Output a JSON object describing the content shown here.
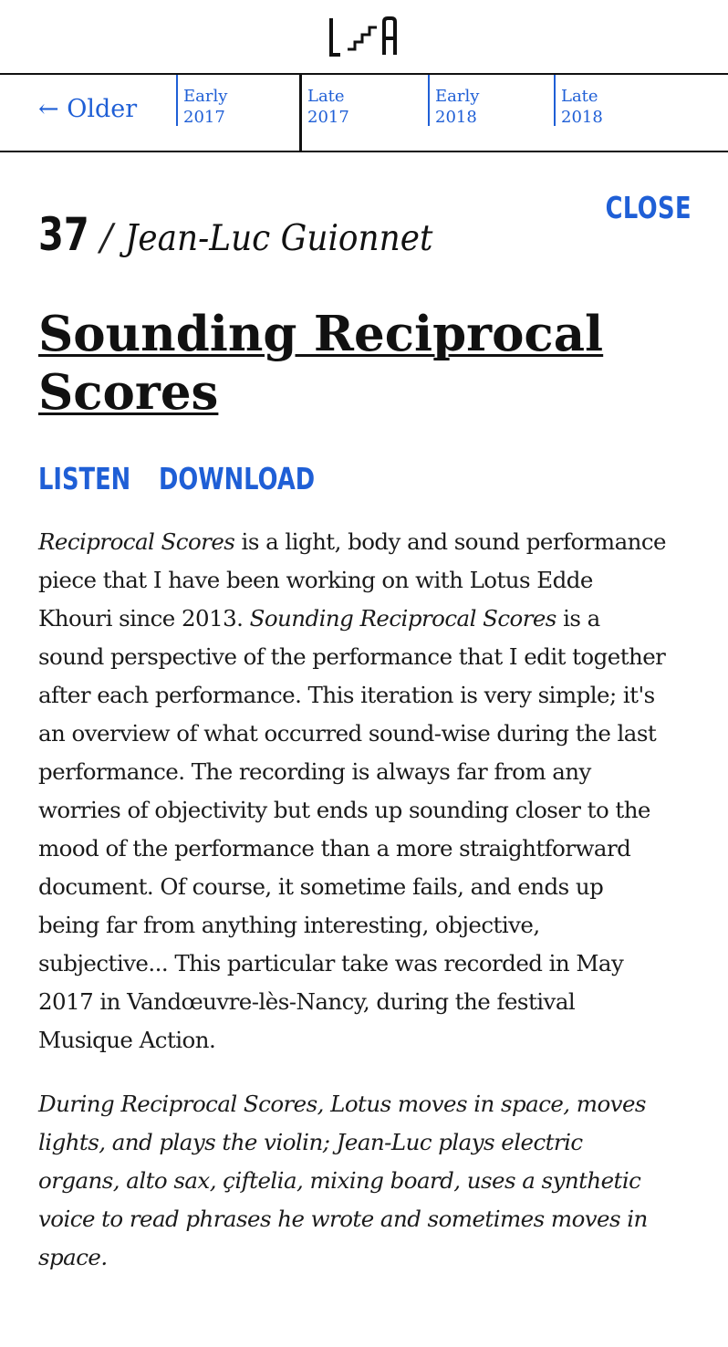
{
  "logo": {
    "icon": "stairs-logo-icon",
    "alt": "L A"
  },
  "timeline": {
    "older_label": "← Older",
    "periods": [
      {
        "line1": "Early",
        "line2": "2017"
      },
      {
        "line1": "Late",
        "line2": "2017"
      },
      {
        "line1": "Early",
        "line2": "2018"
      },
      {
        "line1": "Late",
        "line2": "2018"
      }
    ],
    "current_index": 1
  },
  "entry": {
    "close_label": "CLOSE",
    "number": "37",
    "separator": "/",
    "author": "Jean-Luc Guionnet",
    "title": "Sounding Reciprocal Scores",
    "listen_label": "LISTEN",
    "download_label": "DOWNLOAD",
    "p1": {
      "i1": "Reciprocal Scores",
      "t1": " is a light, body and sound performance piece that I have been working on with Lotus Edde Khouri since 2013. ",
      "i2": "Sounding Reciprocal Scores",
      "t2": " is a sound perspective of the performance that I edit together after each performance. This iteration is very simple; it's an overview of what occurred sound-wise during the last performance. The recording is always far from any worries of objectivity but ends up sounding closer to the mood of the performance than a more straightforward document. Of course, it sometime fails, and ends up being far from anything interesting, objective, subjective... This particular take was recorded in May 2017 in Vandœuvre-lès-Nancy, during the festival Musique Action."
    },
    "credits": "During Reciprocal Scores, Lotus moves in space, moves lights, and plays the violin; Jean-Luc plays electric organs, alto sax, çiftelia, mixing board, uses a synthetic voice to read phrases he wrote and sometimes moves in space."
  },
  "colors": {
    "accent": "#1f5fd6",
    "text": "#111111"
  }
}
